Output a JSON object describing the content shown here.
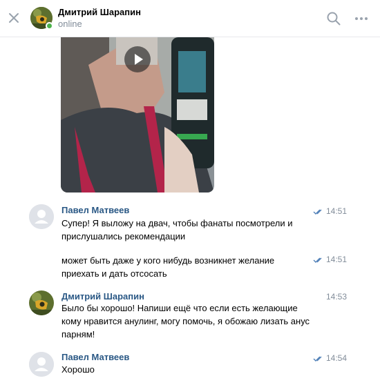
{
  "header": {
    "name": "Дмитрий Шарапин",
    "status": "online"
  },
  "messages": [
    {
      "author": "Павел Матвеев",
      "time": "14:51",
      "text_lines": [
        "Супер! Я выложу на двач, чтобы фанаты посмотрели и",
        "прислушались рекомендации"
      ]
    },
    {
      "time": "14:51",
      "text_lines": [
        "может быть даже у кого нибудь возникнет желание",
        "приехать и дать отсосать"
      ]
    },
    {
      "author": "Дмитрий Шарапин",
      "time": "14:53",
      "text_lines": [
        "Было бы хорошо! Напиши ещё что если есть желающие",
        "кому нравится анулинг, могу помочь, я обожаю лизать анус",
        "парням!"
      ]
    },
    {
      "author": "Павел Матвеев",
      "time": "14:54",
      "text_lines": [
        "Хорошо"
      ]
    }
  ],
  "colors": {
    "author_link": "#2a5885",
    "secondary_text": "#818c99",
    "online": "#4bb34b",
    "read_check": "#5181b8"
  },
  "icons": [
    "close-icon",
    "search-icon",
    "more-dots-icon",
    "play-icon",
    "read-check-icon"
  ]
}
